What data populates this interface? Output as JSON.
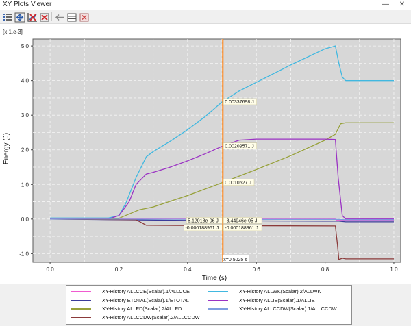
{
  "window": {
    "title": "XY Plots Viewer",
    "minimize_glyph": "—",
    "close_glyph": "✕"
  },
  "toolbar": {
    "buttons": [
      {
        "name": "legend-list-button",
        "icon": "list-icon"
      },
      {
        "name": "fit-view-button",
        "icon": "fit-arrows-icon"
      },
      {
        "name": "delete-curve-button",
        "icon": "chart-delete-icon"
      },
      {
        "name": "delete-all-button",
        "icon": "chart-clear-icon"
      },
      {
        "name": "back-button",
        "icon": "arrow-left-icon"
      },
      {
        "name": "layout-button",
        "icon": "split-layout-icon"
      },
      {
        "name": "close-plot-button",
        "icon": "close-plot-icon"
      }
    ]
  },
  "chart_data": {
    "type": "line",
    "xlabel": "Time (s)",
    "ylabel": "Energy (J)",
    "scale_note": "[x 1.e-3]",
    "xlim": [
      -0.05,
      1.02
    ],
    "ylim": [
      -1.25,
      5.2
    ],
    "xticks": [
      "0.0",
      "0.2",
      "0.4",
      "0.6",
      "0.8",
      "1.0"
    ],
    "xtick_values": [
      0.0,
      0.2,
      0.4,
      0.6,
      0.8,
      1.0
    ],
    "yticks": [
      "-1.0",
      "0.0",
      "1.0",
      "2.0",
      "3.0",
      "4.0",
      "5.0"
    ],
    "ytick_values": [
      -1.0,
      0.0,
      1.0,
      2.0,
      3.0,
      4.0,
      5.0
    ],
    "grid": true,
    "cursor": {
      "x": 0.5025,
      "label": "x=0.5025 s",
      "color": "#ff7f0e",
      "readouts": [
        {
          "text": "0.00337698 J",
          "y": 3.38
        },
        {
          "text": "0.00209571 J",
          "y": 2.1
        },
        {
          "text": "0.0010527 J",
          "y": 1.05
        },
        {
          "text": "5.12018e-06 J",
          "y": -0.05,
          "side": "left"
        },
        {
          "text": "-3.44946e-05 J",
          "y": -0.05
        },
        {
          "text": "-0.000188961 J",
          "y": -0.26,
          "side": "left"
        },
        {
          "text": "-0.000188961 J",
          "y": -0.26
        }
      ]
    },
    "series": [
      {
        "name": "XY-History ALLCCE(Scalar).1/ALLCCE",
        "color": "#f05bd0",
        "x": [
          0.0,
          0.25,
          0.5,
          0.83,
          0.835,
          0.85,
          1.0
        ],
        "y": [
          0.0,
          0.0,
          0.0,
          0.0,
          -0.04,
          -0.03,
          -0.03
        ]
      },
      {
        "name": "XY-History ETOTAL(Scalar).1/ETOTAL",
        "color": "#3b3b9a",
        "x": [
          0.0,
          0.2,
          0.4,
          0.5,
          0.8,
          0.84,
          0.86,
          1.0
        ],
        "y": [
          0.0,
          -0.02,
          -0.04,
          -0.05,
          -0.06,
          -0.06,
          -0.08,
          -0.08
        ]
      },
      {
        "name": "XY-History ALLFD(Scalar).2/ALLFD",
        "color": "#97a13a",
        "x": [
          0.0,
          0.2,
          0.26,
          0.3,
          0.4,
          0.5,
          0.6,
          0.7,
          0.8,
          0.83,
          0.845,
          0.86,
          1.0
        ],
        "y": [
          0.0,
          0.02,
          0.27,
          0.35,
          0.68,
          1.05,
          1.43,
          1.83,
          2.28,
          2.45,
          2.75,
          2.78,
          2.78
        ]
      },
      {
        "name": "XY-History ALLCCDW(Scalar).2/ALLCCDW",
        "color": "#8b3a3a",
        "x": [
          0.0,
          0.25,
          0.28,
          0.5,
          0.83,
          0.836,
          0.84,
          0.85,
          0.86,
          1.0
        ],
        "y": [
          0.0,
          -0.02,
          -0.18,
          -0.19,
          -0.2,
          -0.75,
          -1.17,
          -1.13,
          -1.15,
          -1.15
        ]
      },
      {
        "name": "XY-History ALLWK(Scalar).2/ALLWK",
        "color": "#41b8e0",
        "x": [
          0.0,
          0.17,
          0.2,
          0.22,
          0.25,
          0.28,
          0.3,
          0.35,
          0.4,
          0.45,
          0.5,
          0.55,
          0.6,
          0.7,
          0.8,
          0.83,
          0.84,
          0.85,
          0.86,
          0.9,
          1.0
        ],
        "y": [
          0.03,
          0.03,
          0.1,
          0.45,
          1.2,
          1.8,
          1.95,
          2.25,
          2.58,
          2.95,
          3.38,
          3.7,
          3.95,
          4.45,
          4.92,
          5.0,
          4.5,
          4.1,
          4.0,
          4.0,
          4.0
        ]
      },
      {
        "name": "XY-History ALLIE(Scalar).1/ALLIE",
        "color": "#9b32c4",
        "x": [
          0.0,
          0.17,
          0.2,
          0.23,
          0.25,
          0.28,
          0.3,
          0.35,
          0.4,
          0.45,
          0.5,
          0.55,
          0.6,
          0.7,
          0.8,
          0.83,
          0.838,
          0.85,
          0.86,
          1.0
        ],
        "y": [
          0.0,
          0.0,
          0.1,
          0.5,
          1.0,
          1.3,
          1.35,
          1.5,
          1.68,
          1.88,
          2.1,
          2.28,
          2.31,
          2.31,
          2.31,
          2.3,
          1.2,
          0.1,
          0.0,
          0.0
        ]
      },
      {
        "name": "XY-History ALLCCDW(Scalar).1/ALLCCDW",
        "color": "#7f9ee0",
        "x": [
          0.0,
          0.5,
          0.83,
          0.86,
          1.0
        ],
        "y": [
          0.0,
          -0.01,
          -0.01,
          -0.02,
          -0.02
        ]
      }
    ]
  },
  "legend": {
    "entries": [
      {
        "series": 0,
        "col": 0,
        "row": 0
      },
      {
        "series": 1,
        "col": 0,
        "row": 1
      },
      {
        "series": 2,
        "col": 0,
        "row": 2
      },
      {
        "series": 3,
        "col": 0,
        "row": 3
      },
      {
        "series": 4,
        "col": 1,
        "row": 0
      },
      {
        "series": 5,
        "col": 1,
        "row": 1
      },
      {
        "series": 6,
        "col": 1,
        "row": 2
      }
    ]
  }
}
